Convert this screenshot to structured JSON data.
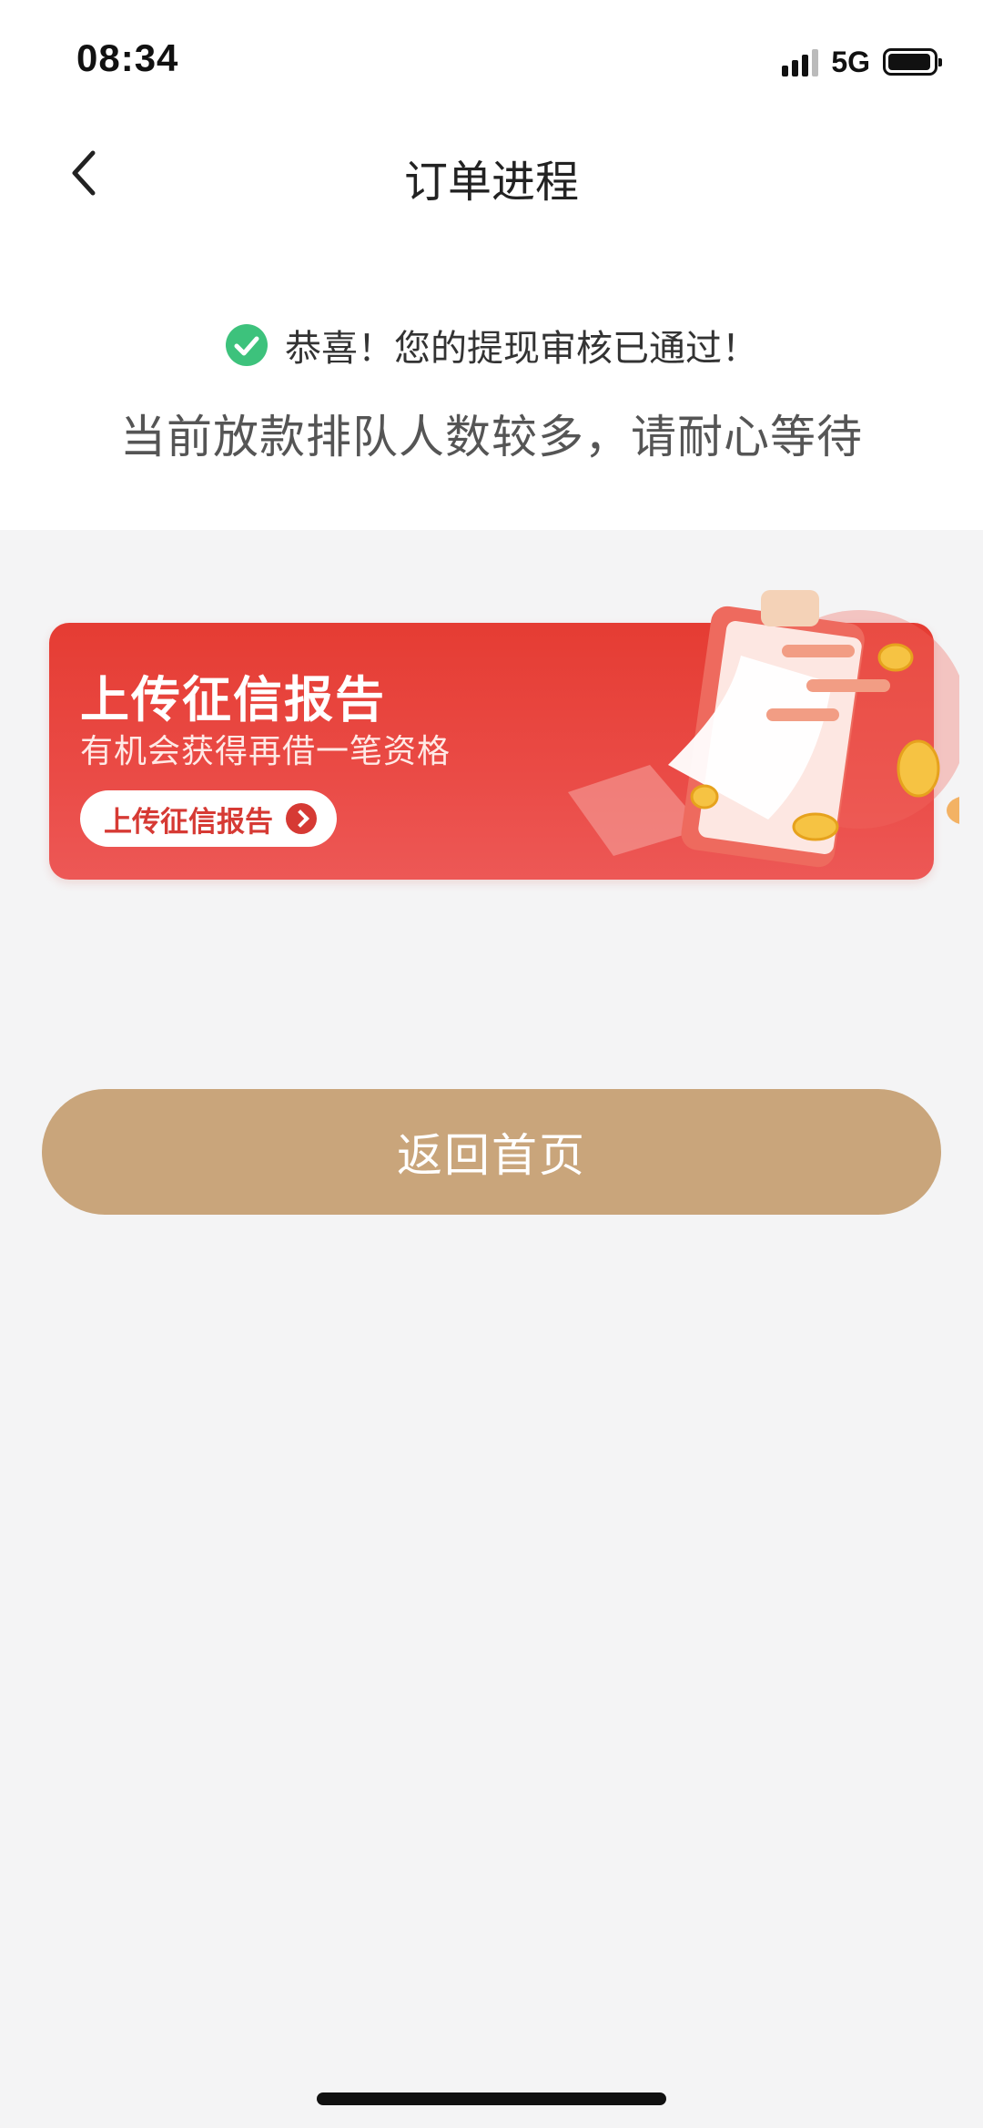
{
  "status_bar": {
    "time": "08:34",
    "network": "5G",
    "icons": [
      "signal-icon",
      "battery-icon"
    ]
  },
  "header": {
    "title": "订单进程",
    "back_icon": "chevron-left-icon"
  },
  "message": {
    "icon": "check-circle-icon",
    "success": "恭喜！您的提现审核已通过！",
    "notice": "当前放款排队人数较多，请耐心等待"
  },
  "banner": {
    "title": "上传征信报告",
    "subtitle": "有机会获得再借一笔资格",
    "button_label": "上传征信报告",
    "button_icon": "arrow-right-circle-icon",
    "illustration": "clipboard-coins-illustration"
  },
  "actions": {
    "home_label": "返回首页"
  },
  "colors": {
    "accent_red": "#e53c33",
    "gold_button": "#c9a57b",
    "success_green": "#3dc27c",
    "page_bg": "#f4f4f5"
  }
}
